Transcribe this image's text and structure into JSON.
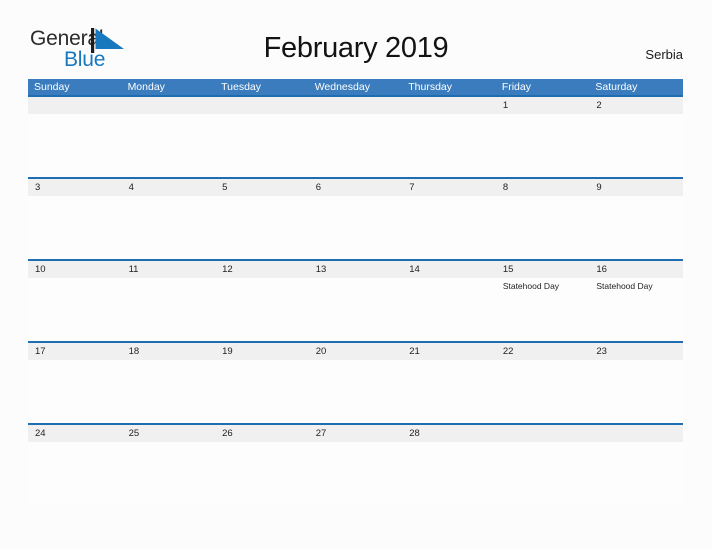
{
  "brand": {
    "name_part1": "General",
    "name_part2": "Blue",
    "flag_icon": "blue-flag-triangle-icon",
    "color_primary": "#1878be",
    "color_text": "#2b2b2b"
  },
  "header": {
    "title": "February 2019",
    "country": "Serbia"
  },
  "theme": {
    "header_blue": "#3a7cbe",
    "row_rule_blue": "#1f6cb0",
    "daynum_band": "#f0f0f0",
    "page_background": "#fcfcfc"
  },
  "calendar": {
    "month": "February",
    "year": "2019",
    "day_names": [
      "Sunday",
      "Monday",
      "Tuesday",
      "Wednesday",
      "Thursday",
      "Friday",
      "Saturday"
    ],
    "weeks": [
      [
        {
          "day": "",
          "events": []
        },
        {
          "day": "",
          "events": []
        },
        {
          "day": "",
          "events": []
        },
        {
          "day": "",
          "events": []
        },
        {
          "day": "",
          "events": []
        },
        {
          "day": "1",
          "events": []
        },
        {
          "day": "2",
          "events": []
        }
      ],
      [
        {
          "day": "3",
          "events": []
        },
        {
          "day": "4",
          "events": []
        },
        {
          "day": "5",
          "events": []
        },
        {
          "day": "6",
          "events": []
        },
        {
          "day": "7",
          "events": []
        },
        {
          "day": "8",
          "events": []
        },
        {
          "day": "9",
          "events": []
        }
      ],
      [
        {
          "day": "10",
          "events": []
        },
        {
          "day": "11",
          "events": []
        },
        {
          "day": "12",
          "events": []
        },
        {
          "day": "13",
          "events": []
        },
        {
          "day": "14",
          "events": []
        },
        {
          "day": "15",
          "events": [
            "Statehood Day"
          ]
        },
        {
          "day": "16",
          "events": [
            "Statehood Day"
          ]
        }
      ],
      [
        {
          "day": "17",
          "events": []
        },
        {
          "day": "18",
          "events": []
        },
        {
          "day": "19",
          "events": []
        },
        {
          "day": "20",
          "events": []
        },
        {
          "day": "21",
          "events": []
        },
        {
          "day": "22",
          "events": []
        },
        {
          "day": "23",
          "events": []
        }
      ],
      [
        {
          "day": "24",
          "events": []
        },
        {
          "day": "25",
          "events": []
        },
        {
          "day": "26",
          "events": []
        },
        {
          "day": "27",
          "events": []
        },
        {
          "day": "28",
          "events": []
        },
        {
          "day": "",
          "events": []
        },
        {
          "day": "",
          "events": []
        }
      ]
    ]
  }
}
